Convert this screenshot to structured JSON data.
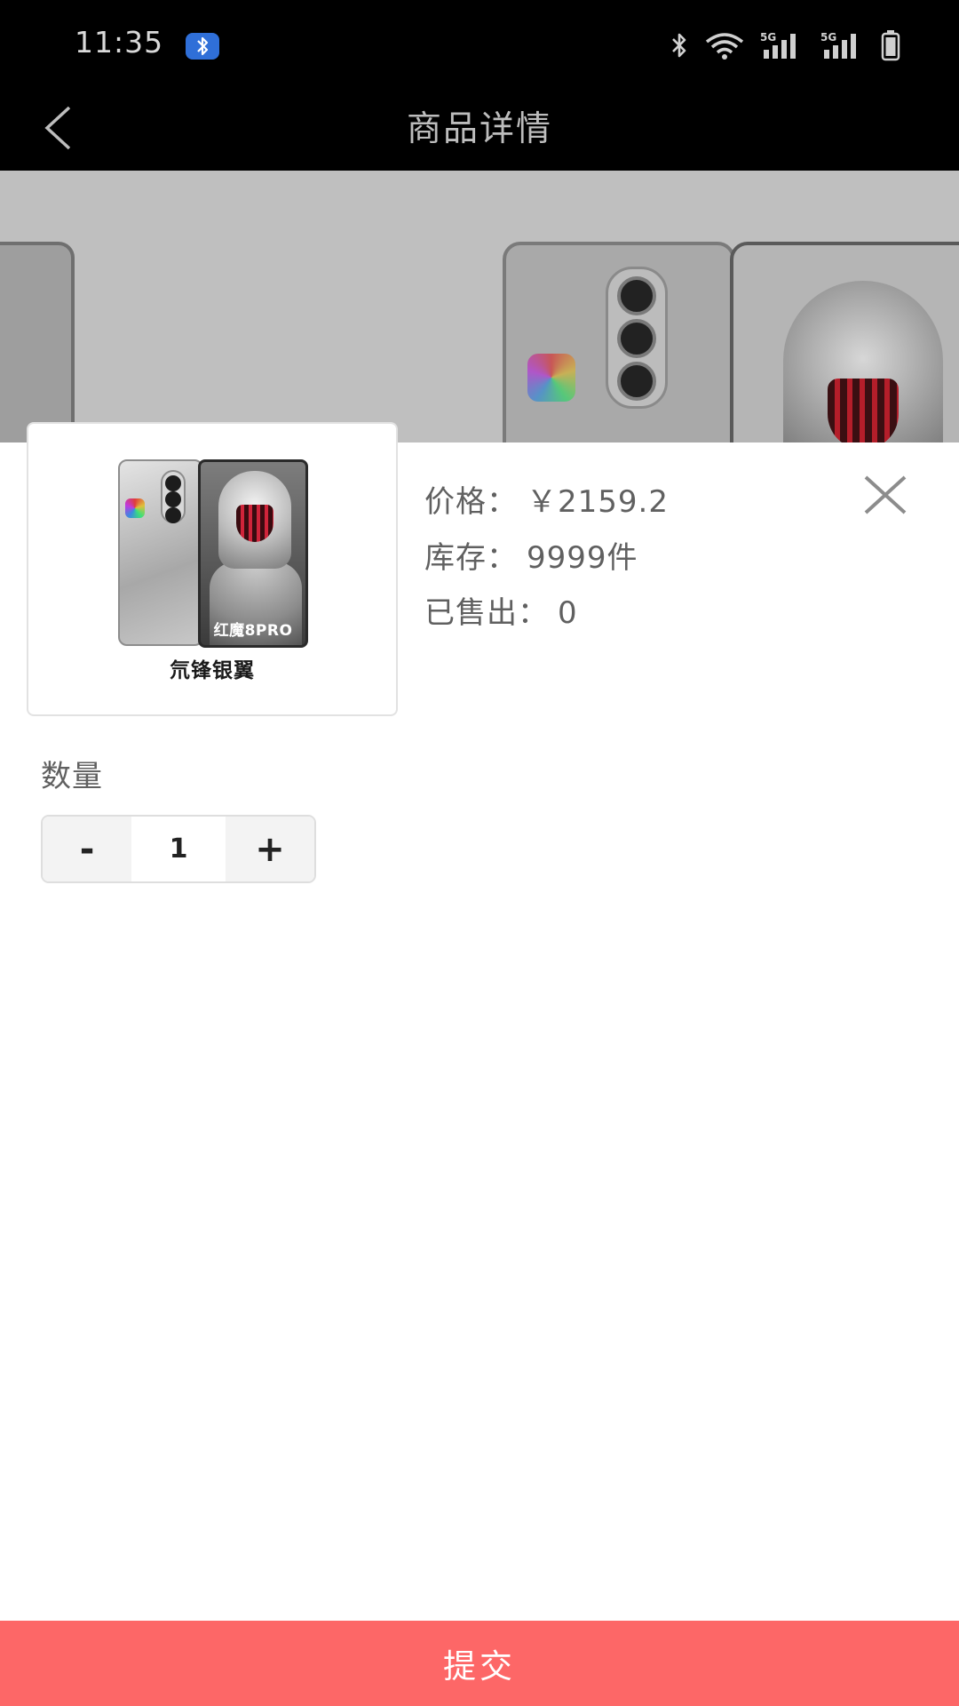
{
  "status_bar": {
    "time": "11:35",
    "network_label_1": "5G",
    "network_label_2": "5G",
    "icons": [
      "bluetooth-badge-icon",
      "bluetooth-icon",
      "wifi-icon",
      "signal-5g-icon",
      "signal-5g-icon",
      "battery-icon"
    ]
  },
  "header": {
    "title": "商品详情",
    "back_icon": "chevron-left-icon"
  },
  "product": {
    "thumbnail_caption": "氘锋银翼",
    "thumbnail_model_text": "红魔8PRO",
    "price_label": "价格：",
    "price_value": "￥2159.2",
    "stock_label": "库存：",
    "stock_value": "9999件",
    "sold_label": "已售出：",
    "sold_value": "0"
  },
  "quantity": {
    "label": "数量",
    "minus": "-",
    "value": "1",
    "plus": "+"
  },
  "actions": {
    "submit_label": "提交",
    "close_icon": "close-icon"
  },
  "colors": {
    "submit_background": "#fd6767",
    "overlay_dim": "#000000",
    "text_gray": "#606060"
  }
}
